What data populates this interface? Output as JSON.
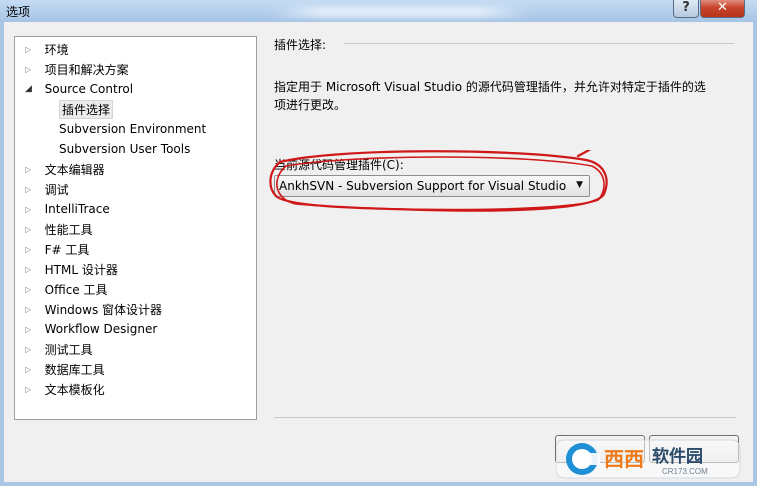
{
  "window": {
    "title": "选项",
    "help_glyph": "?",
    "close_glyph": "✕"
  },
  "tree": {
    "items": [
      {
        "label": "环境",
        "expander": "collapsed"
      },
      {
        "label": "项目和解决方案",
        "expander": "collapsed"
      },
      {
        "label": "Source Control",
        "expander": "expanded"
      },
      {
        "label": "插件选择",
        "expander": "none",
        "selected": true
      },
      {
        "label": "Subversion Environment",
        "expander": "none"
      },
      {
        "label": "Subversion User Tools",
        "expander": "none"
      },
      {
        "label": "文本编辑器",
        "expander": "collapsed"
      },
      {
        "label": "调试",
        "expander": "collapsed"
      },
      {
        "label": "IntelliTrace",
        "expander": "collapsed"
      },
      {
        "label": "性能工具",
        "expander": "collapsed"
      },
      {
        "label": "F# 工具",
        "expander": "collapsed"
      },
      {
        "label": "HTML 设计器",
        "expander": "collapsed"
      },
      {
        "label": "Office 工具",
        "expander": "collapsed"
      },
      {
        "label": "Windows 窗体设计器",
        "expander": "collapsed"
      },
      {
        "label": "Workflow Designer",
        "expander": "collapsed"
      },
      {
        "label": "测试工具",
        "expander": "collapsed"
      },
      {
        "label": "数据库工具",
        "expander": "collapsed"
      },
      {
        "label": "文本模板化",
        "expander": "collapsed"
      }
    ]
  },
  "panel": {
    "header": "插件选择:",
    "description_line1": "指定用于 Microsoft Visual Studio 的源代码管理插件，并允许对特定于插件的选",
    "description_line2": "项进行更改。",
    "combo_label": "当前源代码管理插件(C):",
    "combo_value": "AnkhSVN - Subversion Support for Visual Studio"
  },
  "colors": {
    "annotation": "#d01818",
    "close_button": "#c7442c",
    "watermark_orange": "#f07a1a",
    "watermark_blue": "#1f8fd6"
  },
  "watermark": {
    "brand": "西西",
    "name": "软件园",
    "site": "CR173.COM"
  }
}
